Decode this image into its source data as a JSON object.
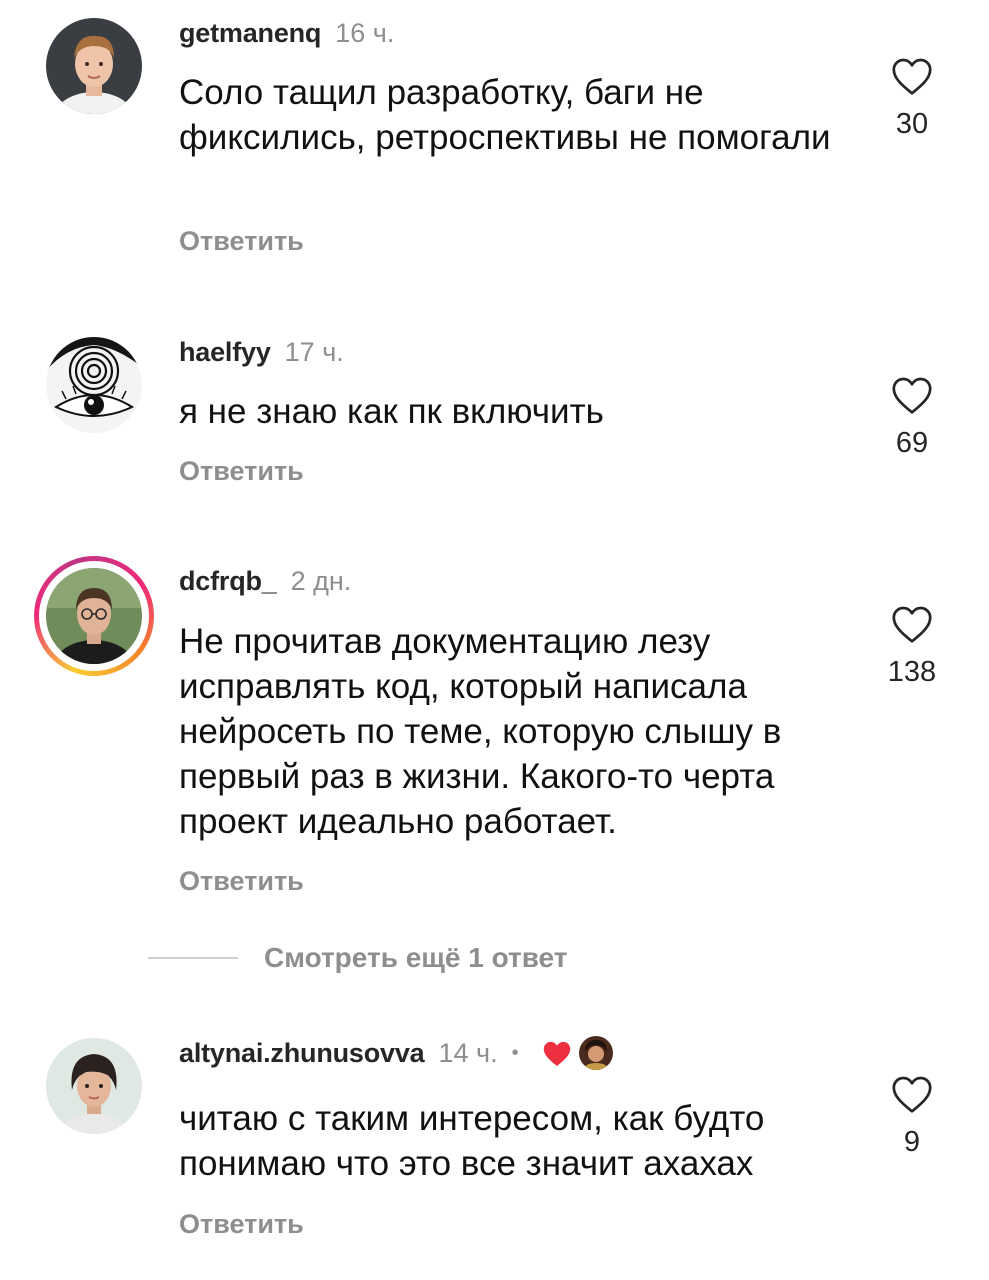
{
  "comments": [
    {
      "username": "getmanenq",
      "time": "16 ч.",
      "text": "Соло тащил разработку, баги не фиксились, ретроспективы не помогали",
      "reply": "Ответить",
      "likes": "30",
      "avatar": "man-portrait-avatar"
    },
    {
      "username": "haelfyy",
      "time": "17 ч.",
      "text": "я не знаю как пк включить",
      "reply": "Ответить",
      "likes": "69",
      "avatar": "manga-spiral-eye-avatar"
    },
    {
      "username": "dcfrqb_",
      "time": "2 дн.",
      "text": "Не прочитав документацию лезу исправлять код, который написала нейросеть по теме, которую слышу в первый раз в жизни. Какого-то черта проект идеально работает.",
      "reply": "Ответить",
      "likes": "138",
      "avatar": "man-glasses-avatar",
      "has_story": true
    },
    {
      "username": "altynai.zhunusovva",
      "time": "14 ч.",
      "separator": "•",
      "text": "читаю с таким интересом, как будто понимаю что это все значит ахахах",
      "reply": "Ответить",
      "likes": "9",
      "avatar": "woman-portrait-avatar",
      "liked_by_creator": true
    }
  ],
  "view_more": "Смотреть ещё 1 ответ",
  "colors": {
    "text": "#111111",
    "secondary": "#8e8e8e",
    "heart_red": "#ed2f3f"
  }
}
